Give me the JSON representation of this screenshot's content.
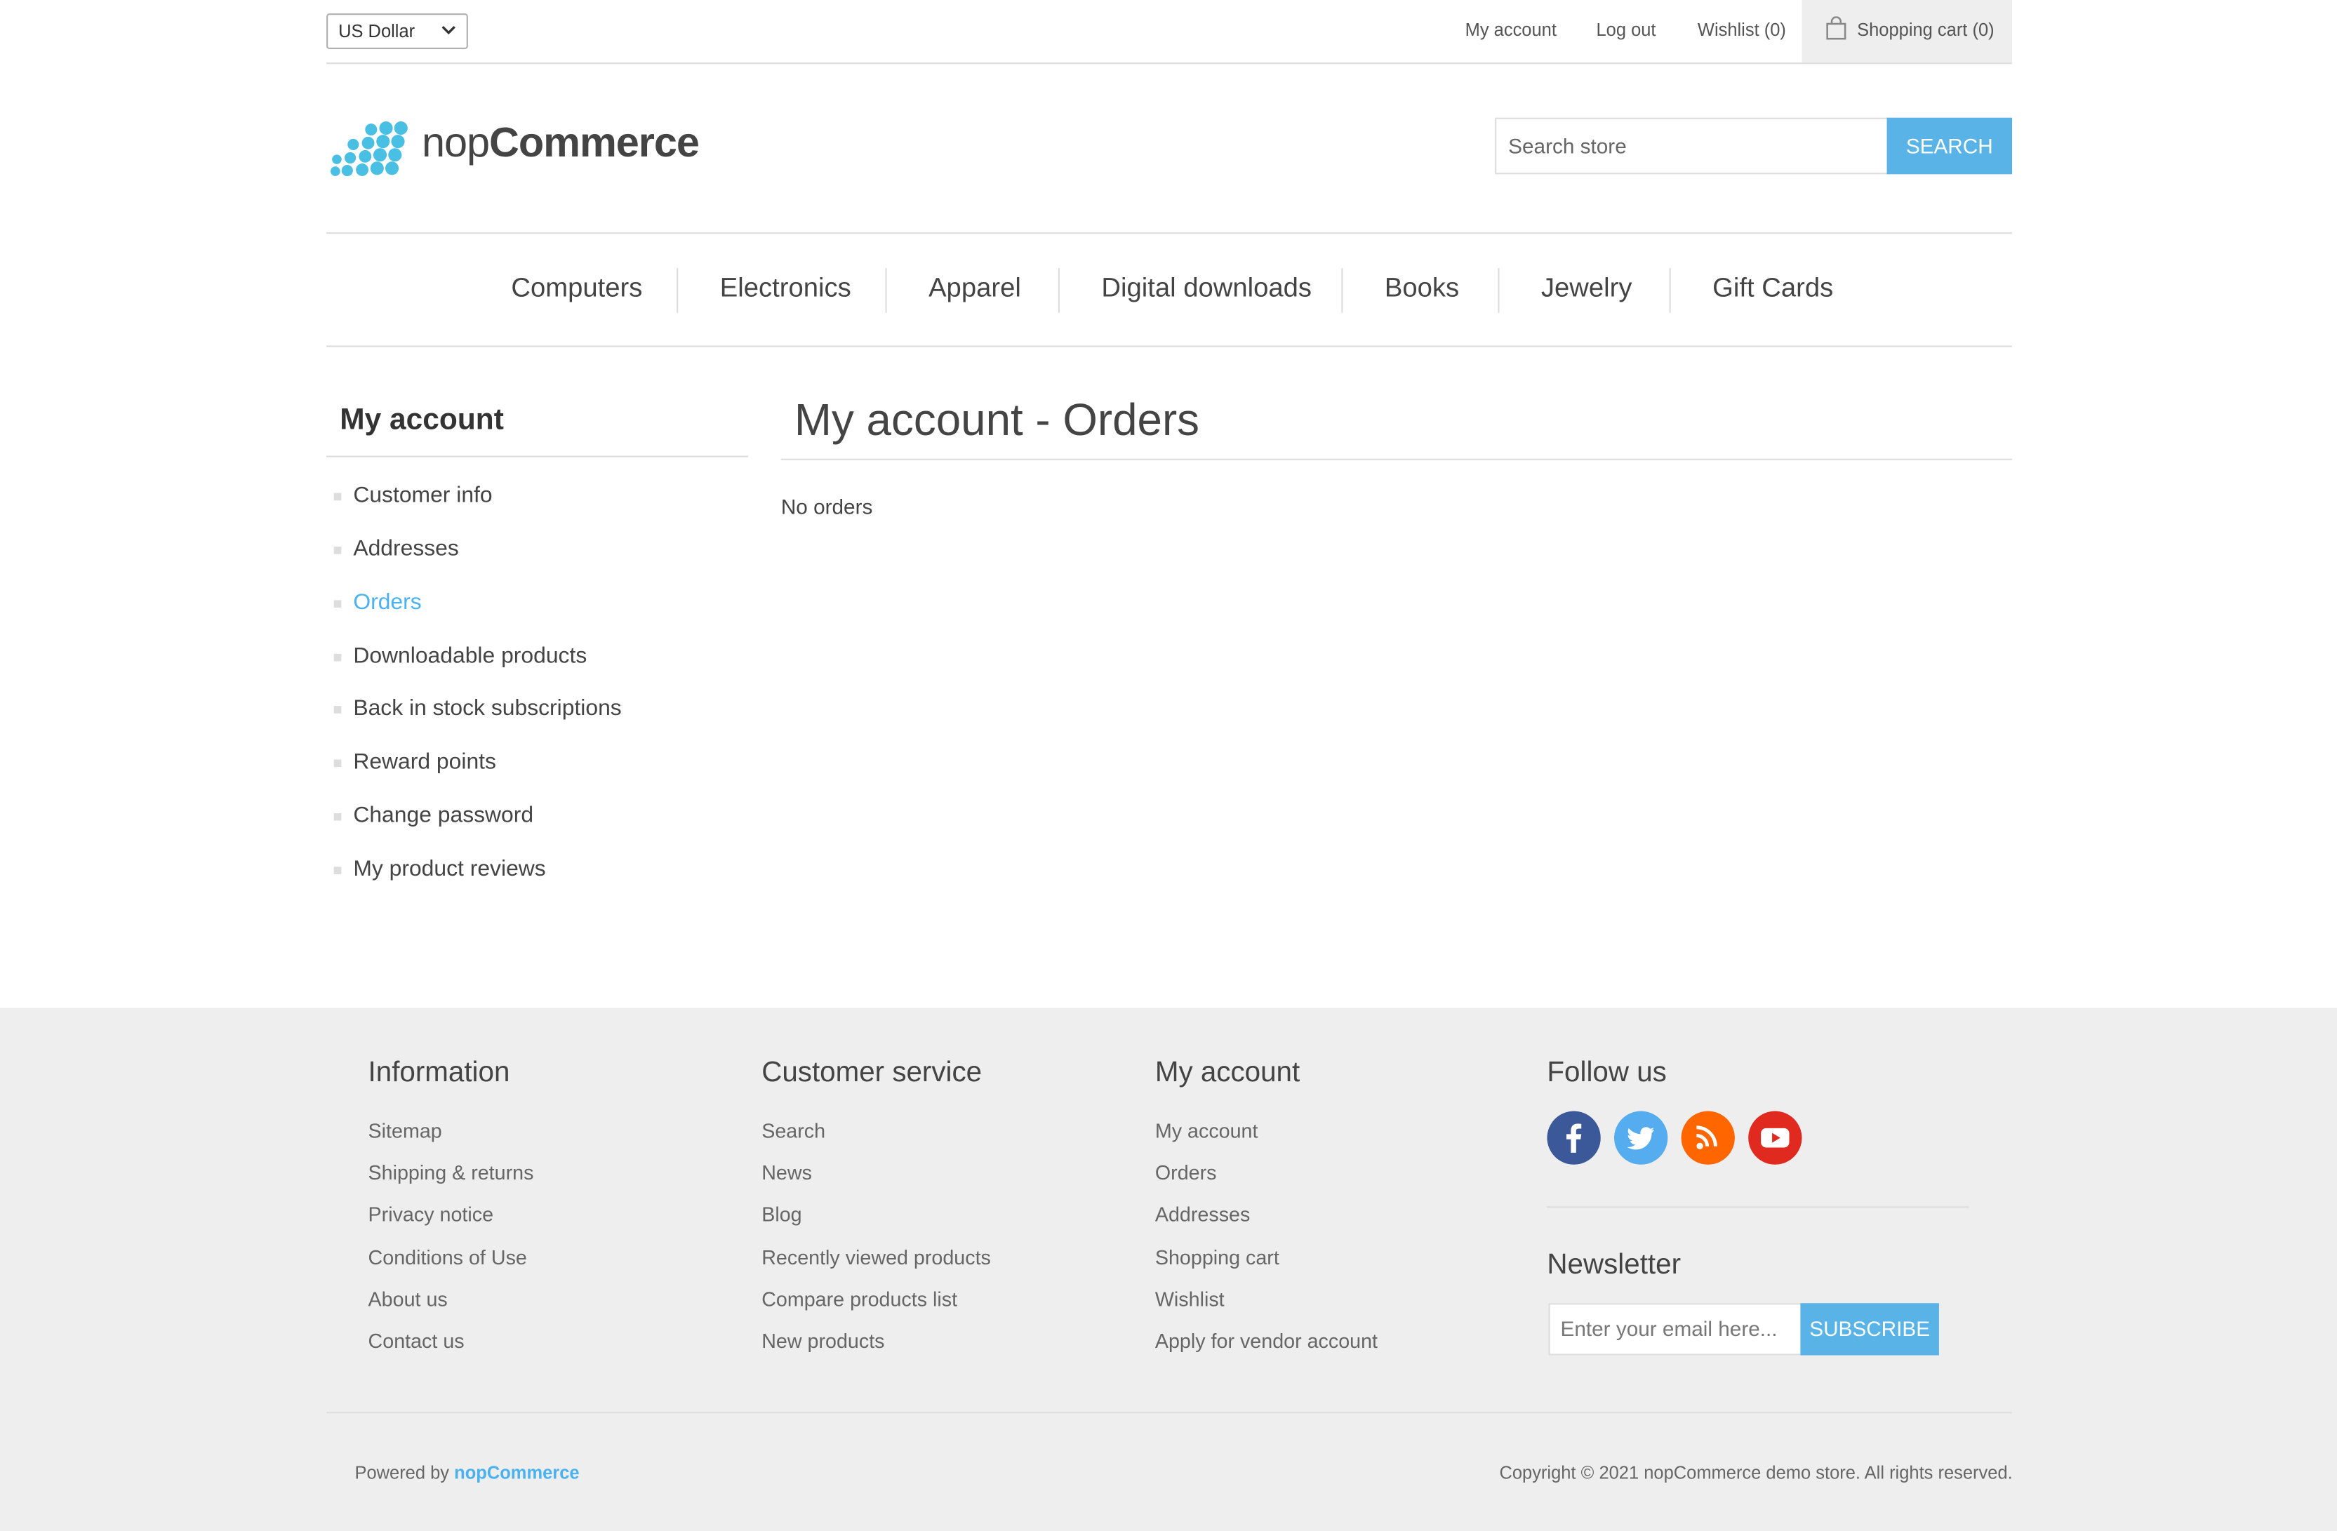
{
  "header": {
    "currency": "US Dollar",
    "links": {
      "my_account": "My account",
      "log_out": "Log out",
      "wishlist": "Wishlist (0)",
      "cart": "Shopping cart (0)"
    }
  },
  "logo": {
    "light": "nop",
    "bold": "Commerce"
  },
  "search": {
    "placeholder": "Search store",
    "button": "SEARCH"
  },
  "nav": [
    "Computers",
    "Electronics",
    "Apparel",
    "Digital downloads",
    "Books",
    "Jewelry",
    "Gift Cards"
  ],
  "sidebar": {
    "title": "My account",
    "items": [
      "Customer info",
      "Addresses",
      "Orders",
      "Downloadable products",
      "Back in stock subscriptions",
      "Reward points",
      "Change password",
      "My product reviews"
    ],
    "active": "Orders"
  },
  "main": {
    "title": "My account - Orders",
    "empty_message": "No orders"
  },
  "footer": {
    "information": {
      "title": "Information",
      "links": [
        "Sitemap",
        "Shipping & returns",
        "Privacy notice",
        "Conditions of Use",
        "About us",
        "Contact us"
      ]
    },
    "customer_service": {
      "title": "Customer service",
      "links": [
        "Search",
        "News",
        "Blog",
        "Recently viewed products",
        "Compare products list",
        "New products"
      ]
    },
    "my_account": {
      "title": "My account",
      "links": [
        "My account",
        "Orders",
        "Addresses",
        "Shopping cart",
        "Wishlist",
        "Apply for vendor account"
      ]
    },
    "follow_us": {
      "title": "Follow us",
      "icons": [
        "facebook-icon",
        "twitter-icon",
        "rss-icon",
        "youtube-icon"
      ]
    },
    "newsletter": {
      "title": "Newsletter",
      "placeholder": "Enter your email here...",
      "button": "SUBSCRIBE"
    },
    "powered_by": "Powered by",
    "powered_brand": "nopCommerce",
    "copyright": "Copyright © 2021 nopCommerce demo store. All rights reserved."
  },
  "colors": {
    "accent": "#4ab2f1",
    "button": "#5ab3e6",
    "footer_bg": "#eeeeee",
    "facebook": "#3b5998",
    "twitter": "#55acee",
    "rss": "#ff6600",
    "youtube": "#e02a20"
  }
}
